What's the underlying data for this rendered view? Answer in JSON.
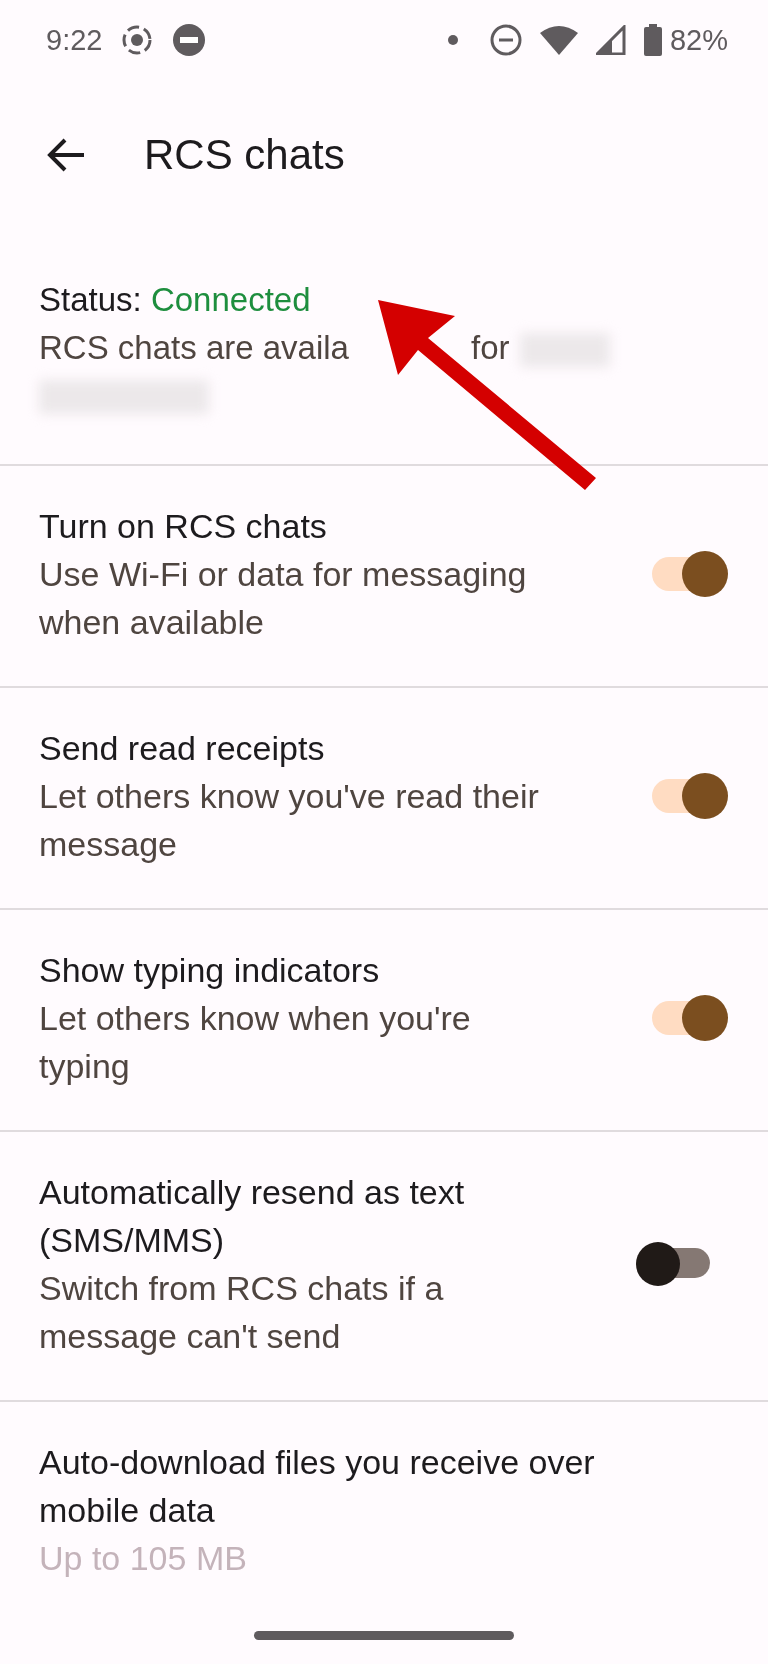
{
  "status_bar": {
    "time": "9:22",
    "battery": "82%"
  },
  "header": {
    "title": "RCS chats"
  },
  "status": {
    "label": "Status:",
    "value": "Connected",
    "description": "RCS chats are availa",
    "description_end": "for"
  },
  "settings": [
    {
      "title": "Turn on RCS chats",
      "subtitle": "Use Wi-Fi or data for messaging when available",
      "on": true
    },
    {
      "title": "Send read receipts",
      "subtitle": "Let others know you've read their message",
      "on": true
    },
    {
      "title": "Show typing indicators",
      "subtitle": "Let others know when you're typing",
      "on": true
    },
    {
      "title": "Automatically resend as text (SMS/MMS)",
      "subtitle": "Switch from RCS chats if a message can't send",
      "on": false
    },
    {
      "title": "Auto-download files you receive over mobile data",
      "subtitle": "Up to 105 MB"
    }
  ]
}
